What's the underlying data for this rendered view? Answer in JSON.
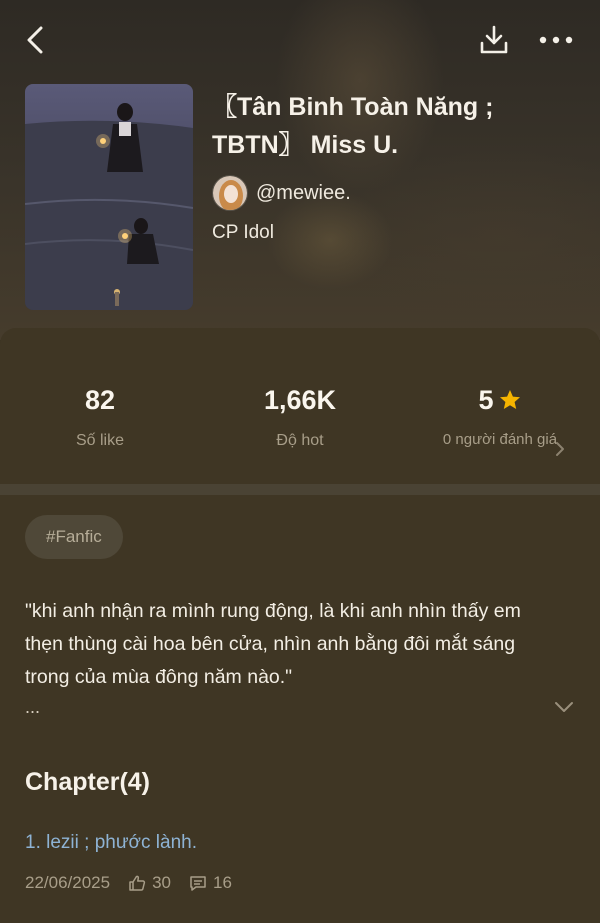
{
  "story": {
    "title": "〖Tân Binh Toàn Năng ;\nTBTN〗 Miss U.",
    "author": "@mewiee.",
    "category": "CP Idol"
  },
  "stats": {
    "likes": {
      "value": "82",
      "label": "Số like"
    },
    "hot": {
      "value": "1,66K",
      "label": "Độ hot"
    },
    "rating": {
      "value": "5",
      "label": "0 người đánh giá"
    }
  },
  "tags": [
    "#Fanfic"
  ],
  "description": {
    "text": "\"khi anh nhận ra mình rung động, là khi anh nhìn thấy em thẹn thùng cài hoa bên cửa, nhìn anh bằng đôi mắt sáng trong của mùa đông năm nào.\"",
    "more": "..."
  },
  "chapters": {
    "heading": "Chapter(4)",
    "items": [
      {
        "title": "1. lezii ; phước lành.",
        "date": "22/06/2025",
        "likes": "30",
        "comments": "16"
      }
    ]
  },
  "icons": {
    "back": "chevron-left-icon",
    "download": "download-icon",
    "more": "more-dots-icon",
    "star": "star-icon",
    "rating_chevron": "chevron-right-icon",
    "expand": "chevron-down-icon",
    "like": "thumbs-up-icon",
    "comment": "comment-icon"
  },
  "colors": {
    "accent_star": "#f5b400",
    "link": "#8eb3d4",
    "background": "#3b3322"
  }
}
